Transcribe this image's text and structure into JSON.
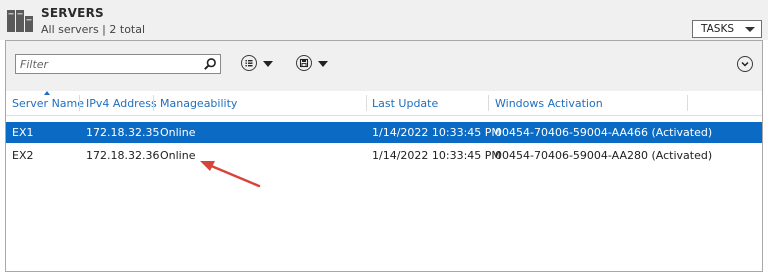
{
  "header": {
    "title": "SERVERS",
    "subtitle": "All servers | 2 total",
    "tasks_label": "TASKS"
  },
  "toolbar": {
    "filter_placeholder": "Filter",
    "filter_value": ""
  },
  "table": {
    "columns": [
      "Server Name",
      "IPv4 Address",
      "Manageability",
      "Last Update",
      "Windows Activation"
    ],
    "sorted_column": "Server Name",
    "sort_direction": "ascending",
    "rows": [
      {
        "server_name": "EX1",
        "ipv4": "172.18.32.35",
        "manageability": "Online",
        "last_update": "1/14/2022 10:33:45 PM",
        "activation": "00454-70406-59004-AA466 (Activated)",
        "selected": true
      },
      {
        "server_name": "EX2",
        "ipv4": "172.18.32.36",
        "manageability": "Online",
        "last_update": "1/14/2022 10:33:45 PM",
        "activation": "00454-70406-59004-AA280 (Activated)",
        "selected": false
      }
    ]
  },
  "colors": {
    "selection": "#0a6ac4",
    "header_text": "#1f6fbf",
    "annotation_arrow": "#d9443a",
    "toolbar_bg": "#f0f0f0"
  },
  "icons": {
    "servers": "server-stack-icon",
    "search": "search-icon",
    "list_view": "list-view-icon",
    "save_query": "save-icon",
    "expand": "chevron-down-circle-icon"
  }
}
